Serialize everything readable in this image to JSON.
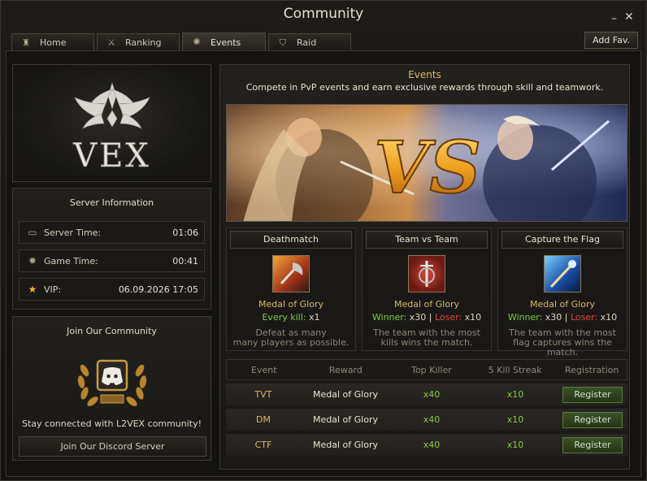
{
  "window": {
    "title": "Community"
  },
  "tabs": [
    {
      "label": "Home",
      "icon": "castle-icon"
    },
    {
      "label": "Ranking",
      "icon": "crossed-swords-icon"
    },
    {
      "label": "Events",
      "icon": "compass-icon"
    },
    {
      "label": "Raid",
      "icon": "helmet-icon"
    }
  ],
  "add_fav_label": "Add Fav.",
  "logo": {
    "text": "VEX"
  },
  "server_info": {
    "title": "Server Information",
    "rows": [
      {
        "label": "Server Time:",
        "value": "01:06",
        "icon": "monitor-icon"
      },
      {
        "label": "Game Time:",
        "value": "00:41",
        "icon": "sun-icon"
      },
      {
        "label": "VIP:",
        "value": "06.09.2026 17:05",
        "icon": "star-icon"
      }
    ]
  },
  "community": {
    "title": "Join Our Community",
    "text": "Stay connected with L2VEX community!",
    "button": "Join Our Discord Server"
  },
  "events": {
    "title": "Events",
    "subtitle": "Compete in PvP events and earn exclusive rewards through skill and teamwork.",
    "banner_text": "VS",
    "cards": [
      {
        "name": "Deathmatch",
        "reward": "Medal of Glory",
        "count_a_label": "Every kill:",
        "count_a_value": "x1",
        "count_b_label": "",
        "count_b_value": "",
        "desc1": "Defeat as many",
        "desc2": "many players as possible."
      },
      {
        "name": "Team vs Team",
        "reward": "Medal of Glory",
        "count_a_label": "Winner:",
        "count_a_value": "x30 |",
        "count_b_label": "Loser:",
        "count_b_value": "x10",
        "desc1": "The team with the most",
        "desc2": "kills wins the match."
      },
      {
        "name": "Capture the Flag",
        "reward": "Medal of Glory",
        "count_a_label": "Winner:",
        "count_a_value": "x30 |",
        "count_b_label": "Loser:",
        "count_b_value": "x10",
        "desc1": "The team with the most",
        "desc2": "flag captures wins the match."
      }
    ],
    "table": {
      "headers": [
        "Event",
        "Reward",
        "Top Killer",
        "5 Kill Streak",
        "Registration"
      ],
      "rows": [
        {
          "event": "TVT",
          "reward": "Medal of Glory",
          "top_killer": "x40",
          "streak": "x10",
          "button": "Register"
        },
        {
          "event": "DM",
          "reward": "Medal of Glory",
          "top_killer": "x40",
          "streak": "x10",
          "button": "Register"
        },
        {
          "event": "CTF",
          "reward": "Medal of Glory",
          "top_killer": "x40",
          "streak": "x10",
          "button": "Register"
        }
      ]
    }
  },
  "colors": {
    "accent_gold": "#d9b86b",
    "green": "#7fcf3a",
    "red": "#e0473a"
  }
}
